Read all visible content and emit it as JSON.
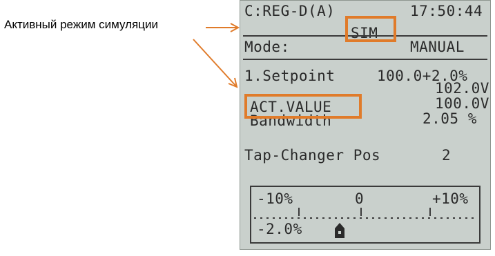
{
  "annotation": "Активный режим симуляции",
  "lcd": {
    "title": "C:REG-D(A)",
    "time": "17:50:44",
    "sim": "SIM",
    "mode_label": "Mode:",
    "mode_value": "MANUAL",
    "setpoint_label": "1.Setpoint",
    "setpoint_value": "100.0+2.0%",
    "setpoint_volt": "102.0V",
    "act_label": "ACT.VALUE",
    "act_value": "100.0V",
    "bandwidth_label": "Bandwidth",
    "bandwidth_value": "2.05 %",
    "tap_label": "Tap-Changer Pos",
    "tap_value": "2",
    "scale_min": "-10%",
    "scale_mid": "0",
    "scale_max": "+10%",
    "scale_current": "-2.0%"
  },
  "colors": {
    "highlight": "#e07b2a",
    "lcd_bg": "#c9d0cc"
  },
  "icons": [
    "pointer-marker-icon",
    "arrow-icon"
  ]
}
